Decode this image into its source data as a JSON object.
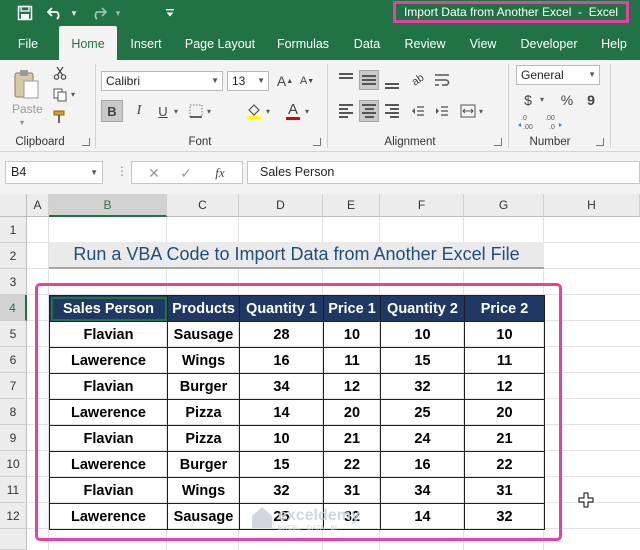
{
  "window": {
    "title": "Import Data from Another Excel  -  Excel"
  },
  "quick_access": [
    {
      "name": "save-icon",
      "glyph": "💾"
    },
    {
      "name": "undo-icon",
      "glyph": "↶"
    },
    {
      "name": "redo-icon",
      "glyph": "↷"
    },
    {
      "name": "customize-icon",
      "glyph": "⌄"
    }
  ],
  "tabs": [
    "File",
    "Home",
    "Insert",
    "Page Layout",
    "Formulas",
    "Data",
    "Review",
    "View",
    "Developer",
    "Help"
  ],
  "active_tab": "Home",
  "ribbon": {
    "clipboard": {
      "label": "Clipboard",
      "paste": "Paste"
    },
    "font": {
      "label": "Font",
      "family": "Calibri",
      "size": "13",
      "bold": "B",
      "italic": "I",
      "underline": "U",
      "grow": "A",
      "shrink": "A"
    },
    "alignment": {
      "label": "Alignment"
    },
    "number": {
      "label": "Number",
      "format": "General",
      "currency": "$",
      "percent": "%",
      "comma": "9",
      "inc_dec": "←.0 .00",
      "dec_dec": ".00 →.0"
    }
  },
  "formula_bar": {
    "name_box": "B4",
    "fx": "fx",
    "value": "Sales Person"
  },
  "columns": [
    "A",
    "B",
    "C",
    "D",
    "E",
    "F",
    "G",
    "H"
  ],
  "rows": [
    "1",
    "2",
    "3",
    "4",
    "5",
    "6",
    "7",
    "8",
    "9",
    "10",
    "11",
    "12"
  ],
  "selected_cell": {
    "column": "B",
    "row": "4"
  },
  "sheet": {
    "heading": "Run a VBA Code to Import Data from Another Excel File",
    "table": {
      "headers": [
        "Sales Person",
        "Products",
        "Quantity 1",
        "Price 1",
        "Quantity 2",
        "Price 2"
      ],
      "rows": [
        [
          "Flavian",
          "Sausage",
          "28",
          "10",
          "10",
          "10"
        ],
        [
          "Lawerence",
          "Wings",
          "16",
          "11",
          "15",
          "11"
        ],
        [
          "Flavian",
          "Burger",
          "34",
          "12",
          "32",
          "12"
        ],
        [
          "Lawerence",
          "Pizza",
          "14",
          "20",
          "25",
          "20"
        ],
        [
          "Flavian",
          "Pizza",
          "10",
          "21",
          "24",
          "21"
        ],
        [
          "Lawerence",
          "Burger",
          "15",
          "22",
          "16",
          "22"
        ],
        [
          "Flavian",
          "Wings",
          "32",
          "31",
          "34",
          "31"
        ],
        [
          "Lawerence",
          "Sausage",
          "25",
          "32",
          "14",
          "32"
        ]
      ]
    }
  },
  "watermark": {
    "brand": "exceldemy",
    "tagline": "EXCEL · DATA · BI"
  },
  "colors": {
    "excel_green": "#217346",
    "table_header_bg": "#1f3864",
    "highlight": "#e83fa3",
    "heading_text": "#1f4e79"
  }
}
